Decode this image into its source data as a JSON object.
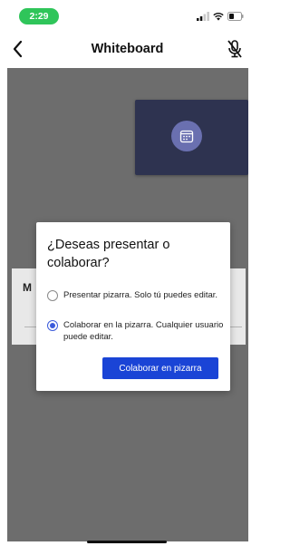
{
  "status_bar": {
    "time": "2:29"
  },
  "nav": {
    "title": "Whiteboard"
  },
  "background_card": {
    "letter": "M"
  },
  "dialog": {
    "title": "¿Deseas presentar o colaborar?",
    "options": [
      {
        "label": "Presentar pizarra. Solo tú puedes editar.",
        "selected": false
      },
      {
        "label": "Colaborar en la pizarra. Cualquier usuario puede editar.",
        "selected": true
      }
    ],
    "primary_button": "Colaborar en pizarra"
  },
  "colors": {
    "accent": "#1a44d6",
    "time_pill": "#2fc55a",
    "video_tile": "#2e3350",
    "overlay": "#6d6d6d"
  },
  "icons": [
    "back-chevron-icon",
    "mic-muted-icon",
    "calendar-icon",
    "signal-icon",
    "wifi-icon",
    "battery-icon"
  ]
}
